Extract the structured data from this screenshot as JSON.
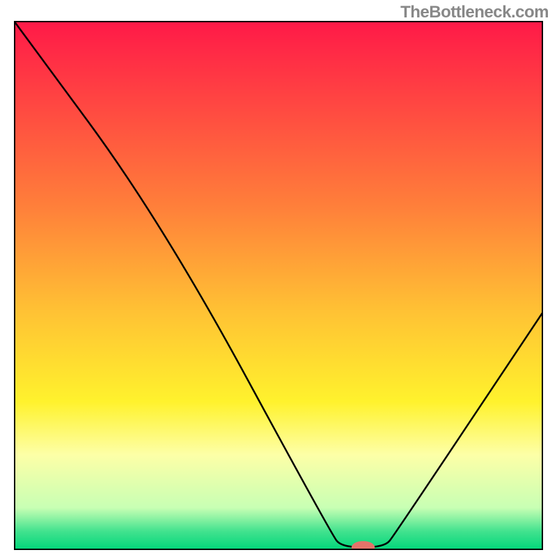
{
  "watermark": "TheBottleneck.com",
  "chart_data": {
    "type": "line",
    "title": "",
    "xlabel": "",
    "ylabel": "",
    "xlim": [
      0,
      100
    ],
    "ylim": [
      0,
      100
    ],
    "gradient_stops": [
      {
        "offset": 0,
        "color": "#ff1948"
      },
      {
        "offset": 35,
        "color": "#ff7f3a"
      },
      {
        "offset": 55,
        "color": "#ffc234"
      },
      {
        "offset": 72,
        "color": "#fff22d"
      },
      {
        "offset": 82,
        "color": "#fdffa7"
      },
      {
        "offset": 92,
        "color": "#c8ffb4"
      },
      {
        "offset": 96.5,
        "color": "#41e28e"
      },
      {
        "offset": 100,
        "color": "#00d67a"
      }
    ],
    "series": [
      {
        "name": "bottleneck-curve",
        "points": [
          {
            "x": 0,
            "y": 100
          },
          {
            "x": 28,
            "y": 62
          },
          {
            "x": 60,
            "y": 3
          },
          {
            "x": 62,
            "y": 0.5
          },
          {
            "x": 70,
            "y": 0.5
          },
          {
            "x": 72,
            "y": 3
          },
          {
            "x": 100,
            "y": 45
          }
        ]
      }
    ],
    "marker": {
      "x": 66,
      "y": 0.5,
      "rx": 2.2,
      "ry": 1.2,
      "color": "#e4746a"
    }
  }
}
